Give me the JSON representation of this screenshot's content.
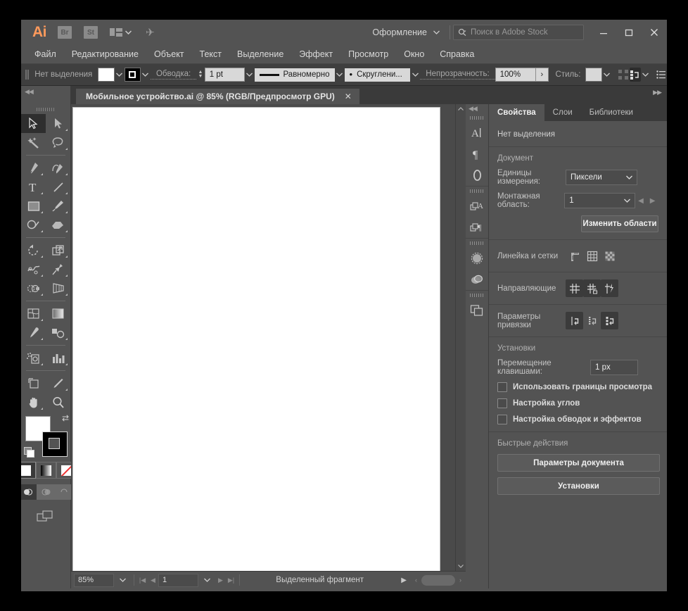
{
  "app": {
    "logo": "Ai",
    "bridge_icon_label": "Br",
    "stock_icon_label": "St",
    "accent_color": "#ff9a5c",
    "chrome_color": "#535353"
  },
  "titlebar": {
    "workspace": "Оформление",
    "stock_search_placeholder": "Поиск в Adobe Stock",
    "minimize": "—",
    "maximize": "□",
    "close": "✕"
  },
  "menubar": {
    "items": [
      "Файл",
      "Редактирование",
      "Объект",
      "Текст",
      "Выделение",
      "Эффект",
      "Просмотр",
      "Окно",
      "Справка"
    ]
  },
  "controlbar": {
    "selection_status": "Нет выделения",
    "stroke_label": "Обводка:",
    "stroke_weight": "1 pt",
    "stroke_profile": "Равномерно",
    "corner_label": "Скруглени...",
    "opacity_label": "Непрозрачность:",
    "opacity_value": "100%",
    "style_label": "Стиль:"
  },
  "document_tab": {
    "title": "Мобильное устройство.ai @ 85% (RGB/Предпросмотр GPU)",
    "close": "✕"
  },
  "toolbar": {
    "tools": [
      "selection-tool",
      "direct-selection-tool",
      "magic-wand-tool",
      "lasso-tool",
      "pen-tool",
      "curvature-tool",
      "type-tool",
      "line-segment-tool",
      "rectangle-tool",
      "paintbrush-tool",
      "shaper-tool",
      "eraser-tool",
      "rotate-tool",
      "scale-tool",
      "width-tool",
      "free-transform-tool",
      "shape-builder-tool",
      "perspective-grid-tool",
      "mesh-tool",
      "gradient-tool",
      "eyedropper-tool",
      "blend-tool",
      "symbol-sprayer-tool",
      "column-graph-tool",
      "artboard-tool",
      "slice-tool",
      "hand-tool",
      "zoom-tool"
    ],
    "fill_color": "#ffffff",
    "stroke_color": "#000000",
    "paint_modes": [
      "color-swatch",
      "gradient-swatch",
      "none-swatch"
    ],
    "draw_modes": [
      "draw-normal",
      "draw-behind",
      "draw-inside"
    ],
    "screen_mode": "change-screen-mode"
  },
  "icon_dock": {
    "groups": [
      [
        "character-panel",
        "paragraph-panel",
        "glyphs-panel"
      ],
      [
        "character-styles-panel",
        "paragraph-styles-panel"
      ],
      [
        "brushes-panel",
        "symbols-panel"
      ],
      [
        "layers-panel"
      ]
    ]
  },
  "properties": {
    "tabs": [
      {
        "label": "Свойства",
        "active": true
      },
      {
        "label": "Слои",
        "active": false
      },
      {
        "label": "Библиотеки",
        "active": false
      }
    ],
    "no_selection": "Нет выделения",
    "document": {
      "title": "Документ",
      "units_label": "Единицы измерения:",
      "units_value": "Пиксели",
      "artboard_label": "Монтажная область:",
      "artboard_value": "1",
      "edit_artboards_button": "Изменить области"
    },
    "rulers": {
      "label": "Линейка и сетки",
      "buttons": [
        "rulers-icon",
        "grid-icon",
        "transparency-grid-icon"
      ]
    },
    "guides": {
      "label": "Направляющие",
      "buttons": [
        "show-guides-icon",
        "lock-guides-icon",
        "smart-guides-icon"
      ]
    },
    "snapping": {
      "label": "Параметры привязки",
      "buttons": [
        "snap-to-point-icon",
        "snap-to-grid-icon",
        "snap-to-pixel-icon"
      ]
    },
    "preferences": {
      "title": "Установки",
      "keyboard_increment_label": "Перемещение клавишами:",
      "keyboard_increment_value": "1 px",
      "checkboxes": [
        {
          "label": "Использовать границы просмотра",
          "checked": false
        },
        {
          "label": "Настройка углов",
          "checked": false
        },
        {
          "label": "Настройка обводок и эффектов",
          "checked": false
        }
      ]
    },
    "quick_actions": {
      "title": "Быстрые действия",
      "buttons": [
        "Параметры документа",
        "Установки"
      ]
    }
  },
  "statusbar": {
    "zoom_value": "85%",
    "page_value": "1",
    "status_text": "Выделенный фрагмент"
  }
}
